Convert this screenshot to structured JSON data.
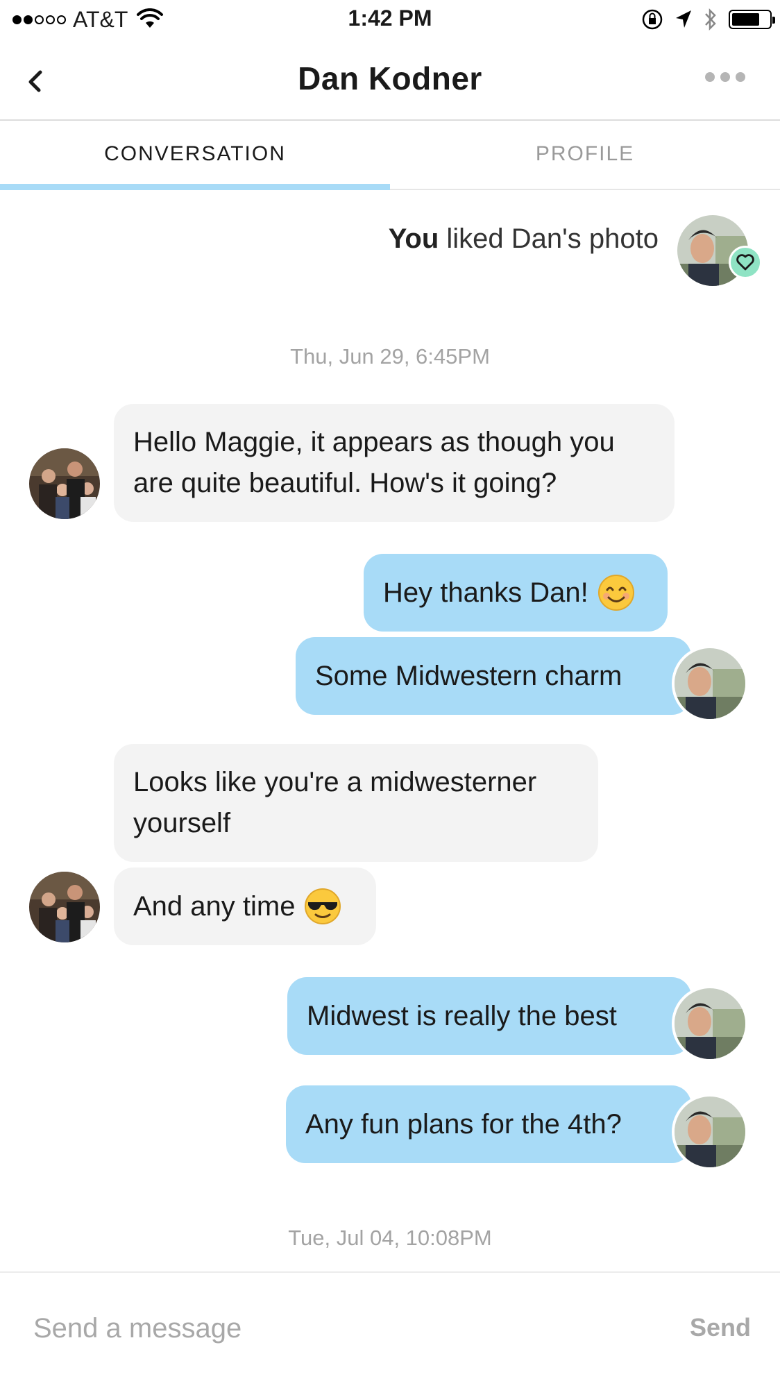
{
  "status_bar": {
    "carrier": "AT&T",
    "time": "1:42 PM",
    "signal_bars_filled": 2,
    "signal_bars_total": 5,
    "battery_level": 0.75
  },
  "nav": {
    "title": "Dan Kodner",
    "back_icon": "chevron-left-icon",
    "more_icon": "more-dots-icon"
  },
  "tabs": [
    {
      "label": "CONVERSATION",
      "active": true
    },
    {
      "label": "PROFILE",
      "active": false
    }
  ],
  "like_notice": {
    "actor": "You",
    "text": "liked Dan's photo",
    "badge_icon": "heart-icon",
    "badge_color": "#8fe3c4"
  },
  "timestamps": [
    "Thu, Jun 29, 6:45PM",
    "Tue, Jul 04, 10:08PM"
  ],
  "messages": [
    {
      "from": "them",
      "text": "Hello Maggie, it appears as though you are quite beautiful. How's it going?"
    },
    {
      "from": "me",
      "text": "Hey thanks Dan!",
      "emoji": "smiling-face-emoji"
    },
    {
      "from": "me",
      "text": "Some Midwestern charm"
    },
    {
      "from": "them",
      "text": "Looks like you're a midwesterner yourself"
    },
    {
      "from": "them",
      "text": "And any time",
      "emoji": "sunglasses-face-emoji"
    },
    {
      "from": "me",
      "text": "Midwest is really the best"
    },
    {
      "from": "me",
      "text": "Any fun plans for the 4th?"
    }
  ],
  "composer": {
    "placeholder": "Send a message",
    "value": "",
    "send_label": "Send"
  },
  "colors": {
    "outgoing_bubble": "#a8dbf7",
    "incoming_bubble": "#f3f3f3",
    "tab_indicator": "#a8dbf7"
  }
}
